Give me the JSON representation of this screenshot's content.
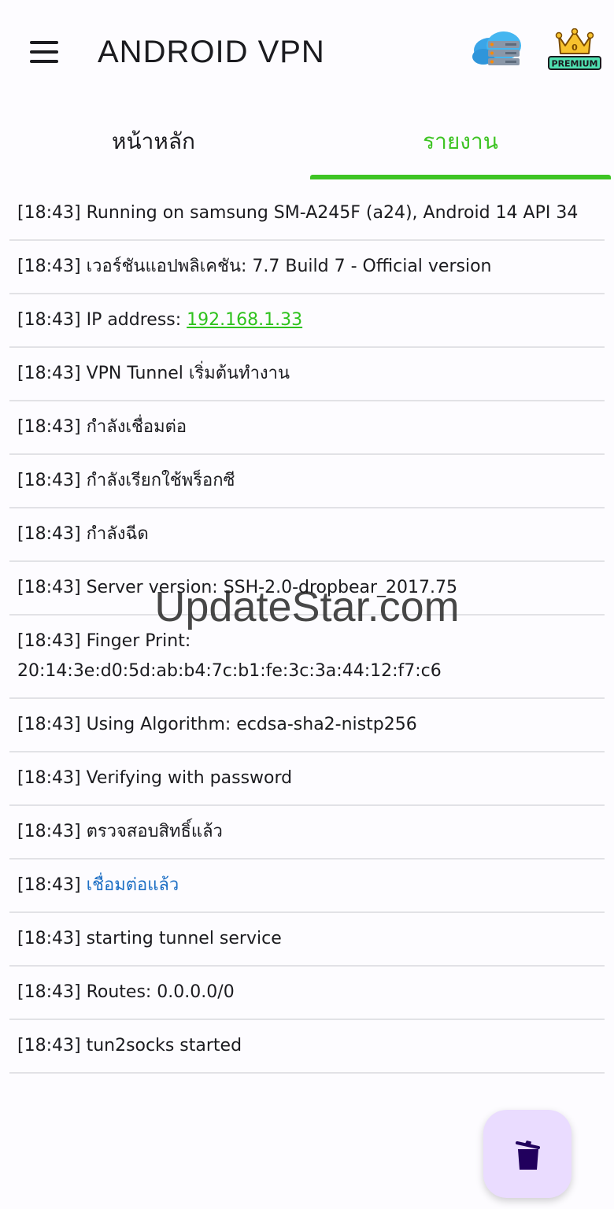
{
  "appbar": {
    "title": "ANDROID  VPN",
    "premium_label": "PREMIUM",
    "premium_count": "0"
  },
  "tabs": [
    {
      "label": "หน้าหลัก",
      "active": false
    },
    {
      "label": "รายงาน",
      "active": true
    }
  ],
  "colors": {
    "accent_green": "#3ec424",
    "link_blue": "#1d6fc4",
    "fab_bg": "#eadcff",
    "fab_icon": "#21005d"
  },
  "log": [
    {
      "time": "[18:43]",
      "text": "Running on samsung SM-A245F (a24), Android 14 API 34"
    },
    {
      "time": "[18:43]",
      "text": "เวอร์ชันแอปพลิเคชัน: 7.7 Build 7 - Official version"
    },
    {
      "time": "[18:43]",
      "prefix": "IP address: ",
      "ip": "192.168.1.33"
    },
    {
      "time": "[18:43]",
      "text": "VPN Tunnel เริ่มต้นทำงาน"
    },
    {
      "time": "[18:43]",
      "text": "กำลังเชื่อมต่อ"
    },
    {
      "time": "[18:43]",
      "text": "กำลังเรียกใช้พร็อกซี"
    },
    {
      "time": "[18:43]",
      "text": "กำลังฉีด"
    },
    {
      "time": "[18:43]",
      "text": "Server version: SSH-2.0-dropbear_2017.75"
    },
    {
      "time": "[18:43]",
      "text": "Finger Print: 20:14:3e:d0:5d:ab:b4:7c:b1:fe:3c:3a:44:12:f7:c6"
    },
    {
      "time": "[18:43]",
      "text": "Using Algorithm: ecdsa-sha2-nistp256"
    },
    {
      "time": "[18:43]",
      "text": "Verifying with password"
    },
    {
      "time": "[18:43]",
      "text": "ตรวจสอบสิทธิ์แล้ว"
    },
    {
      "time": "[18:43]",
      "connected": "เชื่อมต่อแล้ว"
    },
    {
      "time": "[18:43]",
      "text": "starting tunnel service"
    },
    {
      "time": "[18:43]",
      "text": "Routes: 0.0.0.0/0"
    },
    {
      "time": "[18:43]",
      "text": "tun2socks started"
    }
  ],
  "watermark": "UpdateStar.com",
  "icons": {
    "menu": "menu-icon",
    "server": "cloud-server-icon",
    "premium": "crown-premium-icon",
    "fab": "trash-icon"
  }
}
